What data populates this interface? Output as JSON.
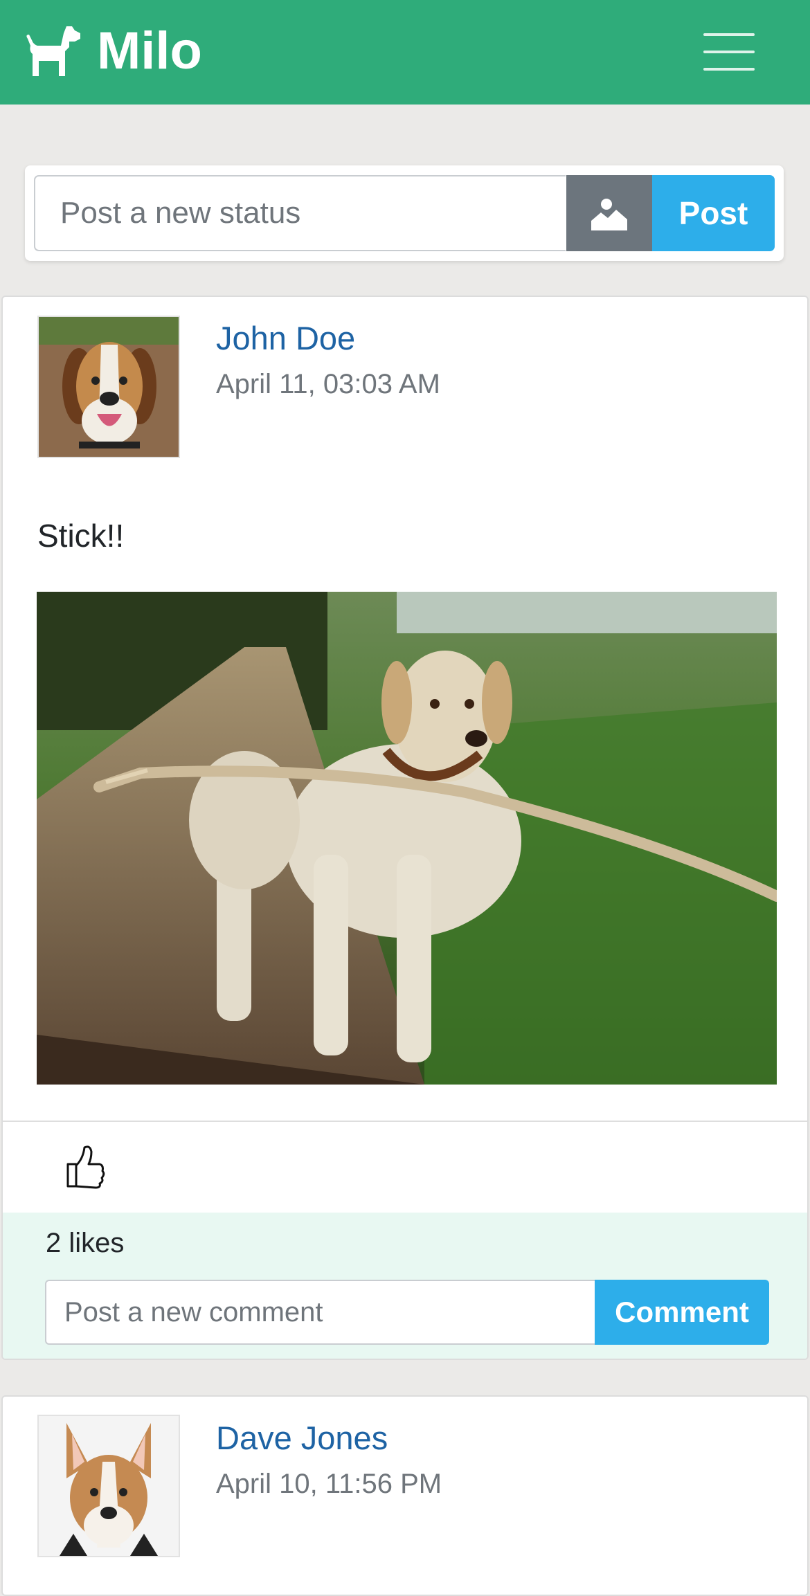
{
  "app": {
    "name": "Milo",
    "brand_color": "#2fac7a",
    "brand_icon": "dog-icon",
    "menu_icon": "hamburger-menu-icon"
  },
  "status_box": {
    "placeholder": "Post a new status",
    "photo_icon": "image-icon",
    "post_label": "Post"
  },
  "posts": [
    {
      "author": "John Doe",
      "timestamp": "April 11, 03:03 AM",
      "avatar": "beagle-avatar",
      "text": "Stick!!",
      "image": "dog-with-stick-photo",
      "like_icon": "thumbs-up-icon",
      "likes": "2 likes",
      "comment_placeholder": "Post a new comment",
      "comment_label": "Comment"
    },
    {
      "author": "Dave Jones",
      "timestamp": "April 10, 11:56 PM",
      "avatar": "corgi-avatar"
    }
  ]
}
